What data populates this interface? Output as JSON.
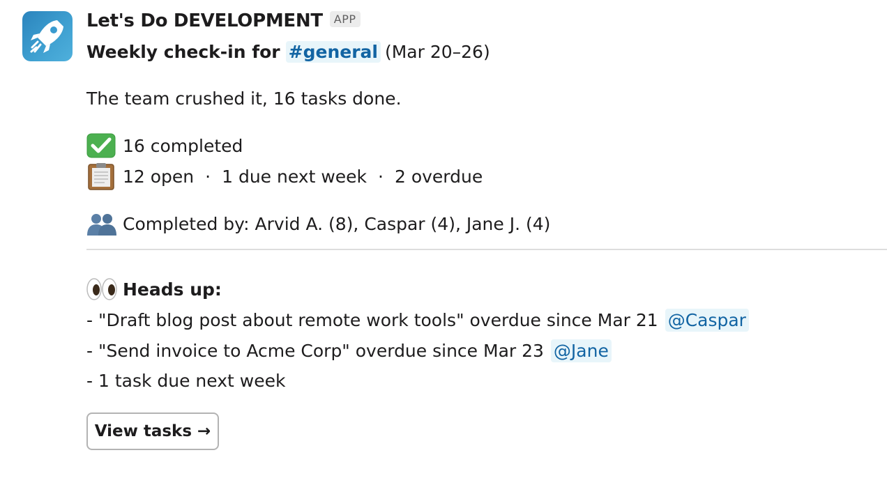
{
  "app": {
    "name": "Let's Do DEVELOPMENT",
    "badge": "APP",
    "avatar_icon": "rocket-icon",
    "avatar_color": "#3a9bcf"
  },
  "message": {
    "title_prefix": "Weekly check-in for",
    "channel": "#general",
    "date_range": "(Mar 20–26)",
    "summary": "The team crushed it, 16 tasks done.",
    "stats": {
      "completed_icon": "check-mark-icon",
      "completed": "16 completed",
      "open_icon": "clipboard-icon",
      "open": "12 open",
      "separator": "·",
      "due_next_week": "1 due next week",
      "overdue": "2 overdue"
    },
    "completed_by": {
      "icon": "people-icon",
      "text": "Completed by: Arvid A. (8), Caspar (4), Jane J. (4)"
    },
    "heads_up": {
      "icon": "eyes-icon",
      "label": "Heads up:",
      "items": [
        {
          "text": "- \"Draft blog post about remote work tools\" overdue since Mar 21",
          "mention": "@Caspar"
        },
        {
          "text": "- \"Send invoice to Acme Corp\" overdue since Mar 23",
          "mention": "@Jane"
        },
        {
          "text": "- 1 task due next week",
          "mention": ""
        }
      ]
    },
    "button_label": "View tasks →"
  },
  "colors": {
    "mention_bg": "#e8f5fa",
    "mention_text": "#1264a3",
    "divider": "#dddddd"
  }
}
